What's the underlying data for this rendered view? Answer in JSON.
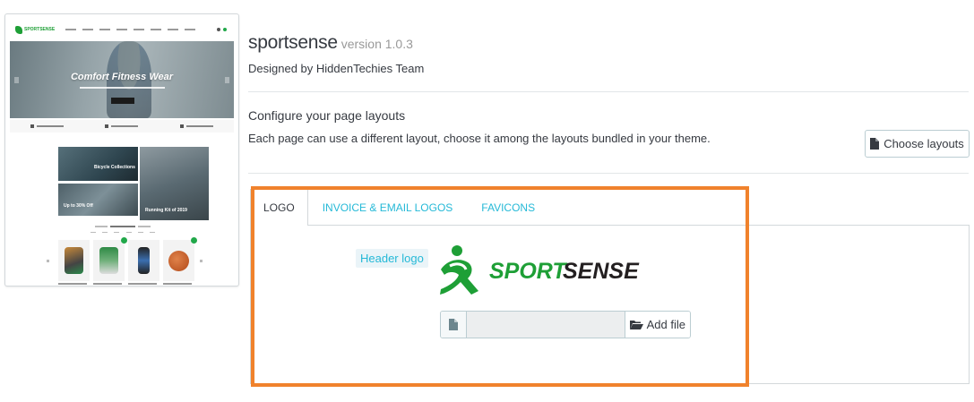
{
  "preview": {
    "hero_title": "Comfort Fitness Wear",
    "tiles": [
      "Bicycle Collections",
      "Up to 30% Off",
      "Running Kit of 2019"
    ]
  },
  "theme": {
    "name": "sportsense",
    "version": "version 1.0.3",
    "designed_by": "Designed by HiddenTechies Team"
  },
  "layouts": {
    "title": "Configure your page layouts",
    "description": "Each page can use a different layout, choose it among the layouts bundled in your theme.",
    "button_label": "Choose layouts"
  },
  "tabs": [
    {
      "label": "LOGO",
      "active": true
    },
    {
      "label": "INVOICE & EMAIL LOGOS",
      "active": false
    },
    {
      "label": "FAVICONS",
      "active": false
    }
  ],
  "logo_panel": {
    "label": "Header logo",
    "logo_text_sport": "SPORT",
    "logo_text_sense": "SENSE",
    "add_file_label": "Add file",
    "file_value": ""
  },
  "colors": {
    "accent": "#25b9d7",
    "highlight": "#f0822c",
    "logo_green": "#1e9f36"
  }
}
